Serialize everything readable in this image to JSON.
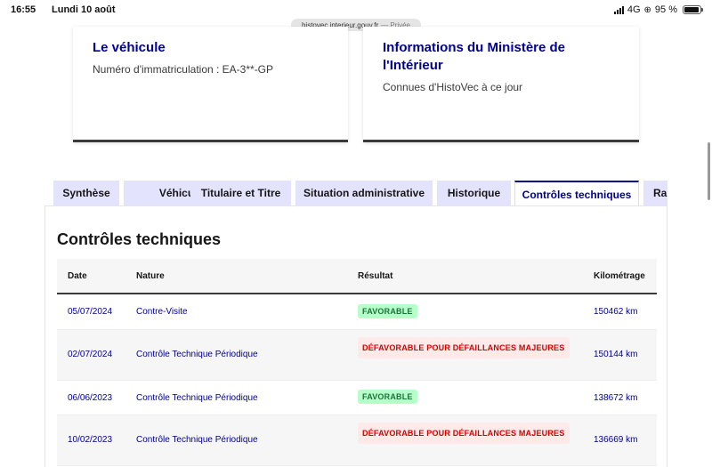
{
  "status_bar": {
    "time": "16:55",
    "date": "Lundi 10 août",
    "network": "4G",
    "battery": "95 %",
    "battery_level": 0.95
  },
  "browser": {
    "url": "histovec.interieur.gouv.fr",
    "private_label": "— Privée"
  },
  "cards": {
    "vehicle": {
      "title": "Le véhicule",
      "plate": "Numéro d'immatriculation : EA-3**-GP"
    },
    "ministry": {
      "title": "Informations du Ministère de l'Intérieur",
      "subtitle": "Connues d'HistoVec à ce jour"
    }
  },
  "tabs": [
    {
      "label": "Synthèse"
    },
    {
      "label": "Véhicule"
    },
    {
      "label": "Titulaire et Titre"
    },
    {
      "label": "Situation administrative"
    },
    {
      "label": "Historique"
    },
    {
      "label": "Contrôles techniques",
      "active": true
    },
    {
      "label": "Rap"
    }
  ],
  "section": {
    "title": "Contrôles techniques"
  },
  "table": {
    "headers": {
      "date": "Date",
      "nature": "Nature",
      "result": "Résultat",
      "mileage": "Kilométrage"
    },
    "rows": [
      {
        "date": "05/07/2024",
        "nature": "Contre-Visite",
        "result": "FAVORABLE",
        "status": "success",
        "mileage": "150462 km"
      },
      {
        "date": "02/07/2024",
        "nature": "Contrôle Technique Périodique",
        "result": "DÉFAVORABLE POUR DÉFAILLANCES MAJEURES",
        "status": "error",
        "mileage": "150144 km"
      },
      {
        "date": "06/06/2023",
        "nature": "Contrôle Technique Périodique",
        "result": "FAVORABLE",
        "status": "success",
        "mileage": "138672 km"
      },
      {
        "date": "10/02/2023",
        "nature": "Contrôle Technique Périodique",
        "result": "DÉFAVORABLE POUR DÉFAILLANCES MAJEURES",
        "status": "error",
        "mileage": "136669 km"
      }
    ]
  }
}
